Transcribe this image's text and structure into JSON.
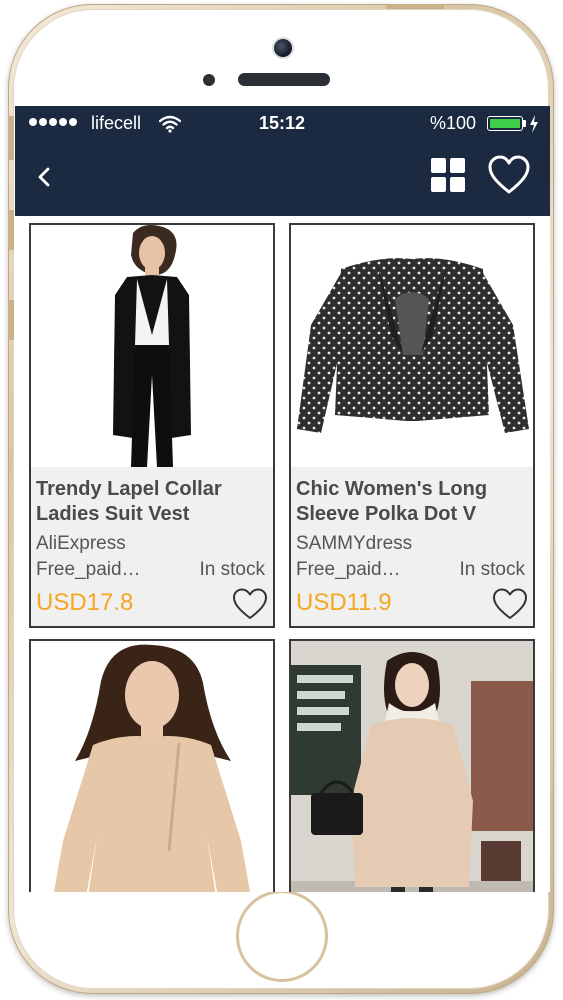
{
  "status_bar": {
    "carrier": "lifecell",
    "time": "15:12",
    "battery": "%100"
  },
  "nav": {
    "back_icon": "chevron-left-icon",
    "grid_icon": "grid-view-icon",
    "favorites_icon": "heart-outline-icon"
  },
  "colors": {
    "header_bg": "#1b2a41",
    "price": "#f5a623",
    "battery_fill": "#3fd04a"
  },
  "products": [
    {
      "title": "Trendy Lapel Collar Ladies Suit Vest",
      "store": "AliExpress",
      "shipping": "Free_paid…",
      "stock": "In stock",
      "price": "USD17.8"
    },
    {
      "title": "Chic Women's Long Sleeve Polka Dot V",
      "store": "SAMMYdress",
      "shipping": "Free_paid…",
      "stock": "In stock",
      "price": "USD11.9"
    },
    {
      "title": "",
      "store": "",
      "shipping": "",
      "stock": "",
      "price": ""
    },
    {
      "title": "",
      "store": "",
      "shipping": "",
      "stock": "",
      "price": ""
    }
  ]
}
